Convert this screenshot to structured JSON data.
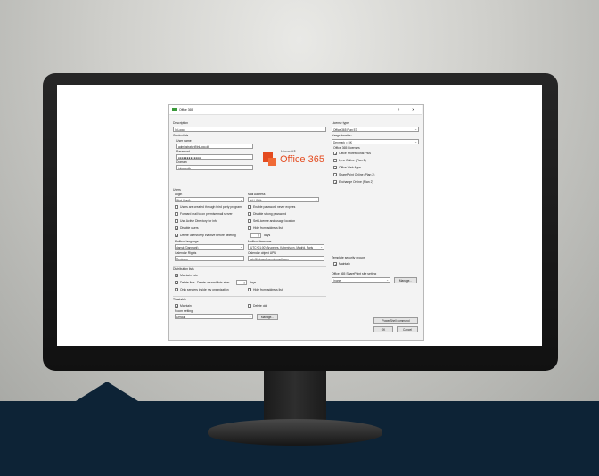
{
  "window": {
    "title": "Office 365",
    "help": "?",
    "close": "✕"
  },
  "left": {
    "description_label": "Description",
    "description_value": "In:Logo",
    "credentials_label": "Credentials",
    "username_label": "User name",
    "username_value": "adminstrator@inLogo.dk",
    "password_label": "Password",
    "password_value": "●●●●●●●●●●●●●",
    "domain_label": "Domain",
    "domain_value": "inLogo.dk",
    "users_label": "Users",
    "login_label": "Login",
    "login_value": "(Not Used)",
    "mail_address_label": "Mail Address",
    "mail_address_value": "%LI_ID%",
    "opt_users_created": "Users are created through third party program",
    "opt_forward_mail": "Forward mail to on premise mail server",
    "opt_active_directory": "Use Active Directory for info",
    "opt_disable_users": "Disable users",
    "opt_delete_users": "Delete users",
    "keep_inactive_label": "Keep inactive before deleting",
    "keep_inactive_value": "7",
    "days_label": "days",
    "opt_password_expires": "Enable password never expires",
    "opt_strong_password": "Disable strong password",
    "opt_set_license": "Set License and usage location",
    "opt_hide_address": "Hide from address list",
    "mailbox_language_label": "Mailbox language",
    "mailbox_language_value": "dansk (Danmark)",
    "mailbox_timezone_label": "Mailbox timezone",
    "mailbox_timezone_value": "(UTC+01:00) Bruxelles, København, Madrid, Paris",
    "calendar_rights_label": "Calendar Rights",
    "calendar_rights_value": "Reviewer",
    "calendar_upn_label": "Calendar object UPN",
    "calendar_upn_value": "uch@inLogo1.onmicrosoft.com",
    "distribution_label": "Distribution lists",
    "opt_maintain_lists": "Maintain lists",
    "opt_delete_lists": "Delete lists",
    "delete_unused_label": "Delete unused lists after",
    "delete_unused_value": "7",
    "days_label2": "days",
    "opt_only_senders": "Only senders inside my organization",
    "opt_hide_address2": "Hide from address list",
    "timetable_label": "Timetable",
    "opt_maintain": "Maintain",
    "opt_delete_old": "Delete old",
    "room_setting_label": "Room setting",
    "room_setting_value": "Default",
    "manage_button": "Manage..."
  },
  "logo": {
    "brand_small": "Microsoft®",
    "brand_big": "Office 365"
  },
  "right": {
    "license_type_label": "License type",
    "license_type_value": "Office 365 Plan E3",
    "usage_location_label": "Usage location",
    "usage_location_value": "Denmark = DK",
    "licenses_label": "Office 365 Licenses",
    "lic_pro_plus": "Office Professional Plus",
    "lic_lync": "Lync Online (Plan 2)",
    "lic_web_apps": "Office Web Apps",
    "lic_sharepoint": "SharePoint Online (Plan 2)",
    "lic_exchange": "Exchange Online (Plan 2)",
    "template_groups_label": "Template security groups",
    "opt_maintain": "Maintain",
    "sharepoint_site_label": "Office 365 SharePoint site setting",
    "sharepoint_site_value": "(none)",
    "manage_button": "Manage...",
    "powershell_button": "PowerShell command",
    "ok_button": "OK",
    "cancel_button": "Cancel"
  },
  "colors": {
    "floor": "#0d2336",
    "office_orange": "#e44b1f"
  }
}
